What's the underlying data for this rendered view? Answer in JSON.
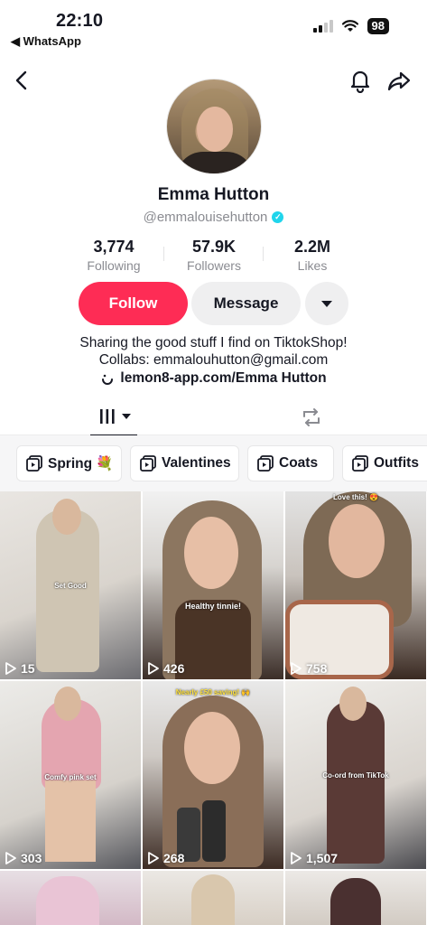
{
  "status_bar": {
    "time": "22:10",
    "back_app": "◀ WhatsApp",
    "battery": "98"
  },
  "profile": {
    "name": "Emma Hutton",
    "handle": "@emmalouisehutton",
    "verified_mark": "✓",
    "stats": [
      {
        "value": "3,774",
        "label": "Following"
      },
      {
        "value": "57.9K",
        "label": "Followers"
      },
      {
        "value": "2.2M",
        "label": "Likes"
      }
    ],
    "follow_label": "Follow",
    "message_label": "Message",
    "bio_line1": "Sharing the good stuff I find on TiktokShop!",
    "bio_line2": "Collabs: emmalouhutton@gmail.com",
    "bio_link": "lemon8-app.com/Emma Hutton"
  },
  "playlists": [
    {
      "label": "Spring 💐"
    },
    {
      "label": "Valentines"
    },
    {
      "label": "Coats"
    },
    {
      "label": "Outfits"
    }
  ],
  "videos": [
    {
      "views": "15",
      "caption": "Set Good"
    },
    {
      "views": "426",
      "caption": "Healthy tinnie!"
    },
    {
      "views": "758",
      "caption": "Love this! 😍"
    },
    {
      "views": "303",
      "caption": "Comfy pink set"
    },
    {
      "views": "268",
      "caption": "Nearly £50 saving! 🙌"
    },
    {
      "views": "1,507",
      "caption": "Co-ord from TikTok"
    },
    {
      "views": "",
      "caption": ""
    },
    {
      "views": "",
      "caption": ""
    },
    {
      "views": "",
      "caption": ""
    }
  ],
  "colors": {
    "accent": "#fe2c55",
    "verified": "#20d5ec"
  }
}
